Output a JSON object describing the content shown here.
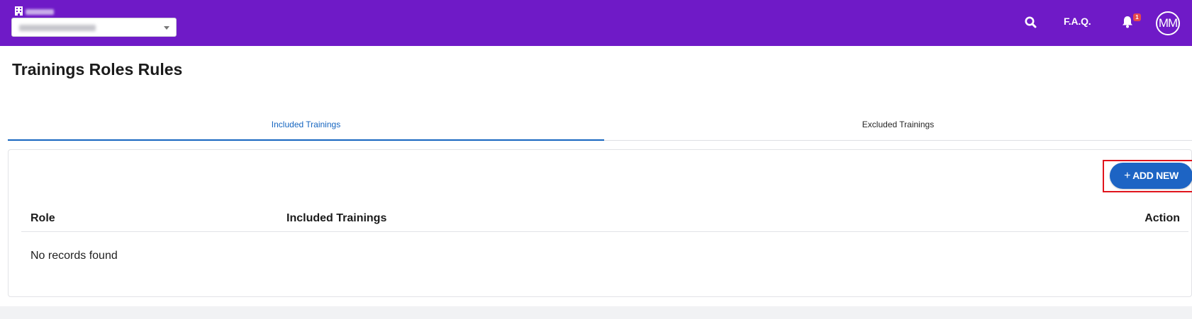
{
  "header": {
    "org_selector": {
      "value": ""
    },
    "faq_label": "F.A.Q.",
    "notifications_count": "1",
    "avatar_initials": "MM",
    "icons": {
      "search": "search-icon",
      "bell": "bell-icon",
      "org": "building-icon"
    }
  },
  "page": {
    "title": "Trainings Roles Rules",
    "tabs": [
      {
        "label": "Included Trainings",
        "active": true
      },
      {
        "label": "Excluded Trainings",
        "active": false
      }
    ],
    "add_button": {
      "plus": "+",
      "label": "ADD NEW"
    },
    "table": {
      "columns": [
        "Role",
        "Included Trainings",
        "Action"
      ],
      "empty_text": "No records found"
    }
  },
  "colors": {
    "topbar": "#6f1ac7",
    "accent": "#1d64c4",
    "highlight_box": "#e0141c"
  }
}
